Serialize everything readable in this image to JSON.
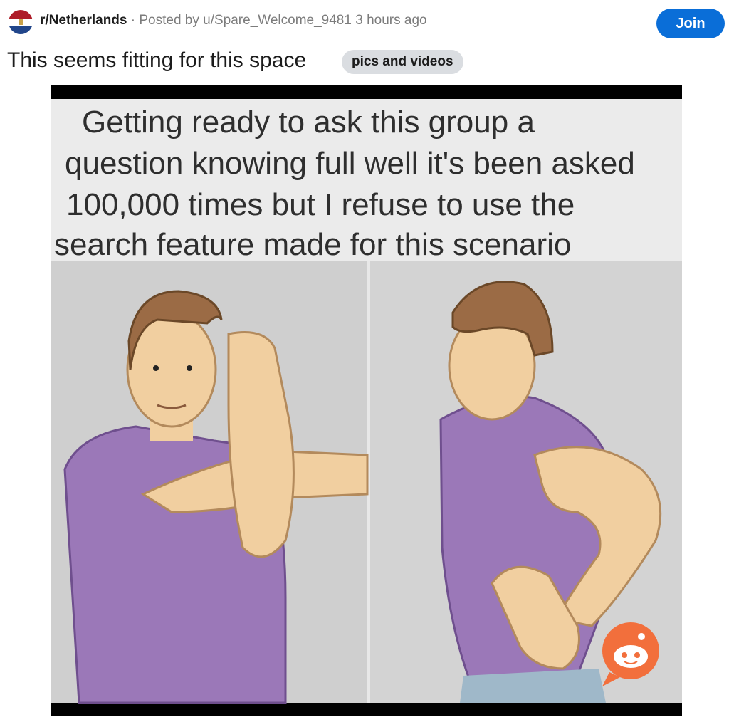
{
  "post": {
    "subreddit": "r/Netherlands",
    "separator": "·",
    "posted_by": "Posted by u/Spare_Welcome_9481",
    "time": "3 hours ago",
    "join_label": "Join",
    "title": "This seems fitting for this space",
    "flair": "pics and videos"
  },
  "meme": {
    "caption": [
      "Getting ready to ask this group a",
      "question knowing full well it's been asked",
      "100,000 times but I refuse to use the",
      "search feature made for this scenario"
    ]
  },
  "colors": {
    "join_button": "#0a6ed8",
    "flair_bg": "#dadde1",
    "shirt": "#9b78b8",
    "skin": "#f1cfa0",
    "hair": "#9b6b45",
    "reddit_badge": "#f26f3c"
  },
  "icons": {
    "subreddit": "netherlands-flag-icon",
    "badge": "reddit-snoo-icon"
  }
}
